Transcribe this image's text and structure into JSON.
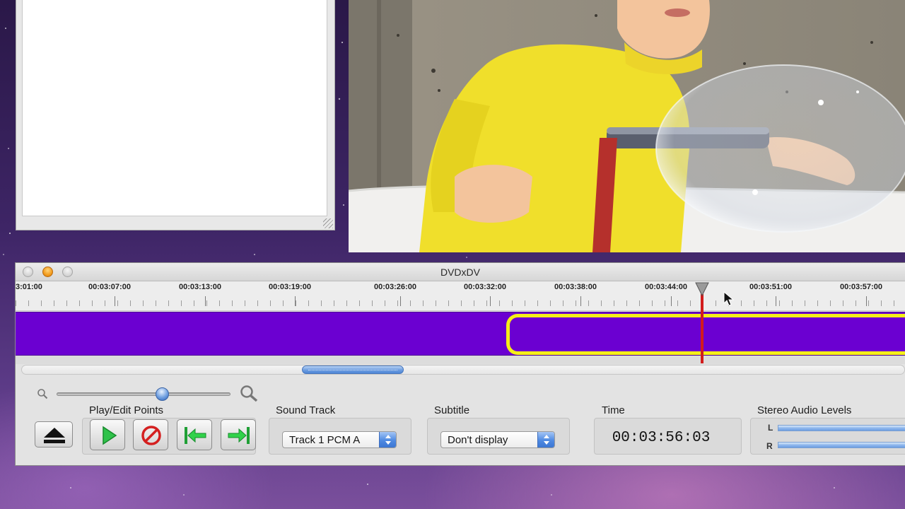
{
  "window": {
    "title": "DVDxDV"
  },
  "ruler": {
    "labels": [
      "3:01:00",
      "00:03:07:00",
      "00:03:13:00",
      "00:03:19:00",
      "00:03:26:00",
      "00:03:32:00",
      "00:03:38:00",
      "00:03:44:00",
      "00:03:51:00",
      "00:03:57:00"
    ]
  },
  "controls": {
    "play_edit_points_label": "Play/Edit Points",
    "sound_track_label": "Sound Track",
    "sound_track_value": "Track 1 PCM A",
    "subtitle_label": "Subtitle",
    "subtitle_value": "Don't display",
    "time_label": "Time",
    "time_value": "00:03:56:03",
    "audio_levels_label": "Stereo Audio Levels",
    "left_channel": "L",
    "right_channel": "R"
  },
  "icons": {
    "eject": "eject-icon",
    "play": "play-icon",
    "clear": "prohibited-icon",
    "go_to_in": "go-to-in-point-icon",
    "go_to_out": "go-to-out-point-icon",
    "zoom_out": "magnifier-small-icon",
    "zoom_in": "magnifier-large-icon"
  },
  "colors": {
    "track": "#6b00d1",
    "selection": "#f5ef18",
    "playhead": "#d21c1c",
    "accent": "#4f8ae2"
  }
}
